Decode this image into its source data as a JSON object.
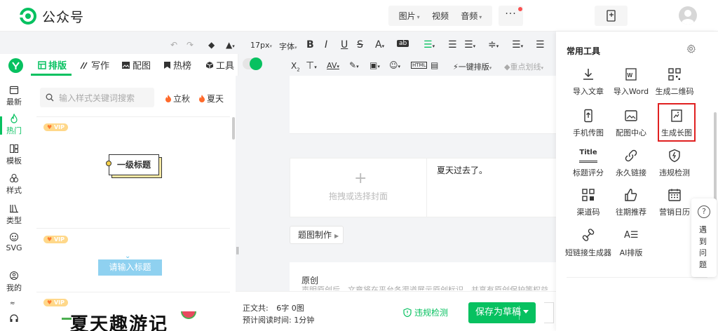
{
  "app": {
    "brand": "公众号"
  },
  "header": {
    "media": [
      {
        "label": "图片",
        "dropdown": true
      },
      {
        "label": "视频",
        "dropdown": false
      },
      {
        "label": "音频",
        "dropdown": true
      }
    ],
    "more_label": "···",
    "accent": "#07c160"
  },
  "sidebar": {
    "items": [
      {
        "label": "最新",
        "icon": "calendar-icon"
      },
      {
        "label": "热门",
        "icon": "flame-icon",
        "active": true
      },
      {
        "label": "模板",
        "icon": "template-icon"
      },
      {
        "label": "样式",
        "icon": "style-icon"
      },
      {
        "label": "类型",
        "icon": "books-icon"
      },
      {
        "label": "SVG",
        "icon": "svg-icon"
      },
      {
        "label": "我的",
        "icon": "user-icon"
      }
    ]
  },
  "panel": {
    "tabs": [
      {
        "label": "排版",
        "icon": "layout-icon",
        "active": true
      },
      {
        "label": "写作",
        "icon": "write-icon"
      },
      {
        "label": "配图",
        "icon": "image-icon"
      },
      {
        "label": "热榜",
        "icon": "bookmark-icon"
      },
      {
        "label": "工具",
        "icon": "cube-icon"
      }
    ],
    "search_placeholder": "输入样式关键词搜索",
    "hot_tags": [
      "立秋",
      "夏天"
    ],
    "vip_label": "VIP",
    "card1_title": "一级标题",
    "card2_title": "请输入标题",
    "card3_title": "夏天趣游记"
  },
  "toolbar": {
    "font_size": "17px",
    "font_label": "字体",
    "one_click": "一键排版",
    "highlight": "重点划线"
  },
  "editor": {
    "cover_placeholder": "拖拽或选择封面",
    "title_text": "夏天过去了。",
    "title_btn": "题图制作",
    "original_label": "原创",
    "original_desc": "声明原创后，文章将在平台各渠道展示原创标识，并享有原创保护等权益"
  },
  "footer": {
    "word_count_label": "正文共:",
    "word_count_value": "6字 0图",
    "read_time_label": "预计阅读时间:",
    "read_time_value": "1分钟",
    "violation": "违规检测",
    "save": "保存为草稿"
  },
  "tools": {
    "title": "常用工具",
    "items": [
      {
        "label": "导入文章",
        "icon": "download-icon"
      },
      {
        "label": "导入Word",
        "icon": "word-icon"
      },
      {
        "label": "生成二维码",
        "icon": "qrcode-icon"
      },
      {
        "label": "手机传图",
        "icon": "phone-upload-icon"
      },
      {
        "label": "配图中心",
        "icon": "gallery-icon"
      },
      {
        "label": "生成长图",
        "icon": "long-image-icon",
        "highlighted": true
      },
      {
        "label": "标题评分",
        "icon": "title-icon"
      },
      {
        "label": "永久链接",
        "icon": "link-icon"
      },
      {
        "label": "违规检测",
        "icon": "shield-icon"
      },
      {
        "label": "渠道码",
        "icon": "channel-qr-icon"
      },
      {
        "label": "往期推荐",
        "icon": "thumbs-up-icon"
      },
      {
        "label": "营销日历",
        "icon": "calendar-grid-icon"
      },
      {
        "label": "短链接生成器",
        "icon": "short-link-icon"
      },
      {
        "label": "AI排版",
        "icon": "ai-layout-icon"
      }
    ],
    "title_icon_text": "Title",
    "ai_icon_text": "A☰"
  },
  "help": {
    "chars": [
      "遇",
      "到",
      "问",
      "题"
    ],
    "icon_text": "?"
  }
}
